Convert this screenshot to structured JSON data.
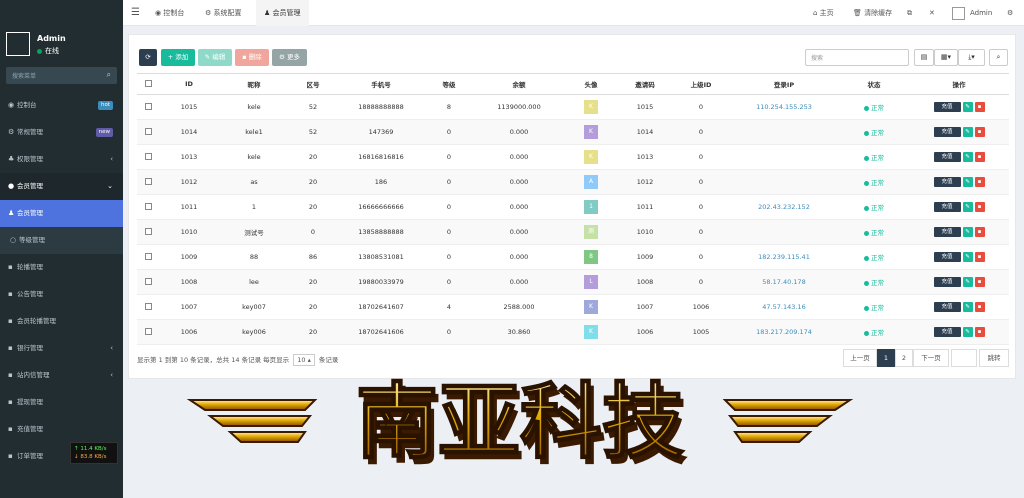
{
  "sidebar": {
    "user_name": "Admin",
    "status": "在线",
    "search_placeholder": "搜索菜单",
    "items": [
      {
        "label": "控制台",
        "icon": "dashboard-icon",
        "badge": "hot",
        "badge_color": "#3c8dbc"
      },
      {
        "label": "常规管理",
        "icon": "cogs-icon",
        "badge": "new",
        "badge_color": "#605ca8"
      },
      {
        "label": "权限管理",
        "icon": "group-icon",
        "arrow": "‹"
      },
      {
        "label": "会员管理",
        "icon": "user-circle-icon",
        "arrow": "⌄"
      },
      {
        "label": "会员管理",
        "icon": "user-icon",
        "active": true
      },
      {
        "label": "等级管理",
        "icon": "circle-icon"
      },
      {
        "label": "轮播管理"
      },
      {
        "label": "公告管理"
      },
      {
        "label": "会员轮播管理"
      },
      {
        "label": "银行管理",
        "arrow": "‹"
      },
      {
        "label": "站内信管理",
        "arrow": "‹"
      },
      {
        "label": "提现管理"
      },
      {
        "label": "充值管理"
      },
      {
        "label": "订单管理"
      }
    ],
    "net_up": "↑ 11.4 KB/s",
    "net_down": "↓ 83.8 KB/s"
  },
  "topbar": {
    "tabs": [
      "控制台",
      "系统配置",
      "会员管理"
    ],
    "home": "主页",
    "clear_cache": "清除缓存",
    "user": "Admin"
  },
  "toolbar": {
    "add": "添加",
    "edit": "编辑",
    "delete": "删除",
    "more": "更多",
    "search_placeholder": "搜索"
  },
  "table": {
    "headers": [
      "ID",
      "昵称",
      "区号",
      "手机号",
      "等级",
      "余额",
      "头像",
      "邀请码",
      "上级ID",
      "登录IP",
      "状态",
      "操作"
    ],
    "rows": [
      {
        "id": "1015",
        "nick": "kele",
        "area": "52",
        "phone": "18888888888",
        "level": "8",
        "balance": "1139000.000",
        "avatar": "K",
        "avatar_color": "#e6df8c",
        "code": "1015",
        "parent": "0",
        "ip": "110.254.155.253",
        "status": "正常"
      },
      {
        "id": "1014",
        "nick": "kele1",
        "area": "52",
        "phone": "147369",
        "level": "0",
        "balance": "0.000",
        "avatar": "K",
        "avatar_color": "#b39ddb",
        "code": "1014",
        "parent": "0",
        "ip": "",
        "status": "正常"
      },
      {
        "id": "1013",
        "nick": "kele",
        "area": "20",
        "phone": "16816816816",
        "level": "0",
        "balance": "0.000",
        "avatar": "K",
        "avatar_color": "#e6df8c",
        "code": "1013",
        "parent": "0",
        "ip": "",
        "status": "正常"
      },
      {
        "id": "1012",
        "nick": "as",
        "area": "20",
        "phone": "186",
        "level": "0",
        "balance": "0.000",
        "avatar": "A",
        "avatar_color": "#90caf9",
        "code": "1012",
        "parent": "0",
        "ip": "",
        "status": "正常"
      },
      {
        "id": "1011",
        "nick": "1",
        "area": "20",
        "phone": "16666666666",
        "level": "0",
        "balance": "0.000",
        "avatar": "1",
        "avatar_color": "#80cbc4",
        "code": "1011",
        "parent": "0",
        "ip": "202.43.232.152",
        "status": "正常"
      },
      {
        "id": "1010",
        "nick": "测试号",
        "area": "0",
        "phone": "13858888888",
        "level": "0",
        "balance": "0.000",
        "avatar": "测",
        "avatar_color": "#c5e1a5",
        "code": "1010",
        "parent": "0",
        "ip": "",
        "status": "正常"
      },
      {
        "id": "1009",
        "nick": "88",
        "area": "86",
        "phone": "13808531081",
        "level": "0",
        "balance": "0.000",
        "avatar": "8",
        "avatar_color": "#81c784",
        "code": "1009",
        "parent": "0",
        "ip": "182.239.115.41",
        "status": "正常"
      },
      {
        "id": "1008",
        "nick": "lee",
        "area": "20",
        "phone": "19880033979",
        "level": "0",
        "balance": "0.000",
        "avatar": "L",
        "avatar_color": "#b39ddb",
        "code": "1008",
        "parent": "0",
        "ip": "58.17.40.178",
        "status": "正常"
      },
      {
        "id": "1007",
        "nick": "key007",
        "area": "20",
        "phone": "18702641607",
        "level": "4",
        "balance": "2588.000",
        "avatar": "K",
        "avatar_color": "#9fa8da",
        "code": "1007",
        "parent": "1006",
        "ip": "47.57.143.16",
        "status": "正常"
      },
      {
        "id": "1006",
        "nick": "key006",
        "area": "20",
        "phone": "18702641606",
        "level": "0",
        "balance": "30.860",
        "avatar": "K",
        "avatar_color": "#80deea",
        "code": "1006",
        "parent": "1005",
        "ip": "183.217.209.174",
        "status": "正常"
      }
    ],
    "charge_label": "充值"
  },
  "footer": {
    "info_pre": "显示第 1 到第 10 条记录，总共 14 条记录 每页显示",
    "page_size": "10",
    "info_post": "条记录",
    "prev": "上一页",
    "pages": [
      "1",
      "2"
    ],
    "next": "下一页",
    "jump": "跳转"
  },
  "banner": {
    "text": "南亚科技"
  }
}
